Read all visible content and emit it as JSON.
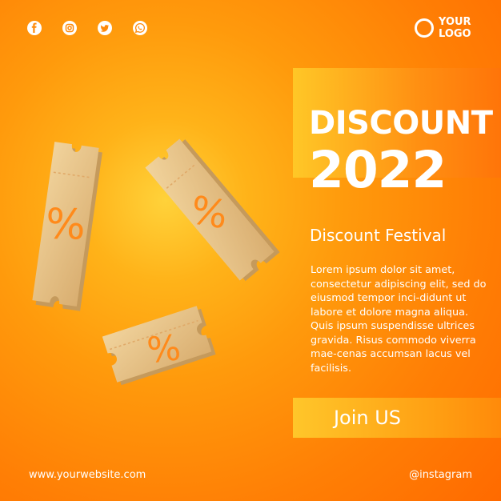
{
  "social": [
    {
      "icon": "facebook-icon"
    },
    {
      "icon": "instagram-icon"
    },
    {
      "icon": "twitter-icon"
    },
    {
      "icon": "whatsapp-icon"
    }
  ],
  "logo": {
    "text": "YOUR LOGO"
  },
  "headline": "DISCOUNT",
  "year": "2022",
  "subheading": "Discount Festival",
  "body": "Lorem ipsum dolor sit amet, consectetur adipiscing elit, sed do eiusmod tempor inci-didunt ut labore et dolore magna aliqua. Quis ipsum suspendisse ultrices gravida. Risus commodo viverra mae-cenas accumsan lacus vel facilisis.",
  "cta": "Join US",
  "footer": {
    "website": "www.yourwebsite.com",
    "instagram": "@instagram"
  },
  "ticket_symbol": "%",
  "colors": {
    "accent": "#ff8a0a",
    "ticket": "#e8c48c",
    "ticket_symbol": "#ff8a1a"
  }
}
